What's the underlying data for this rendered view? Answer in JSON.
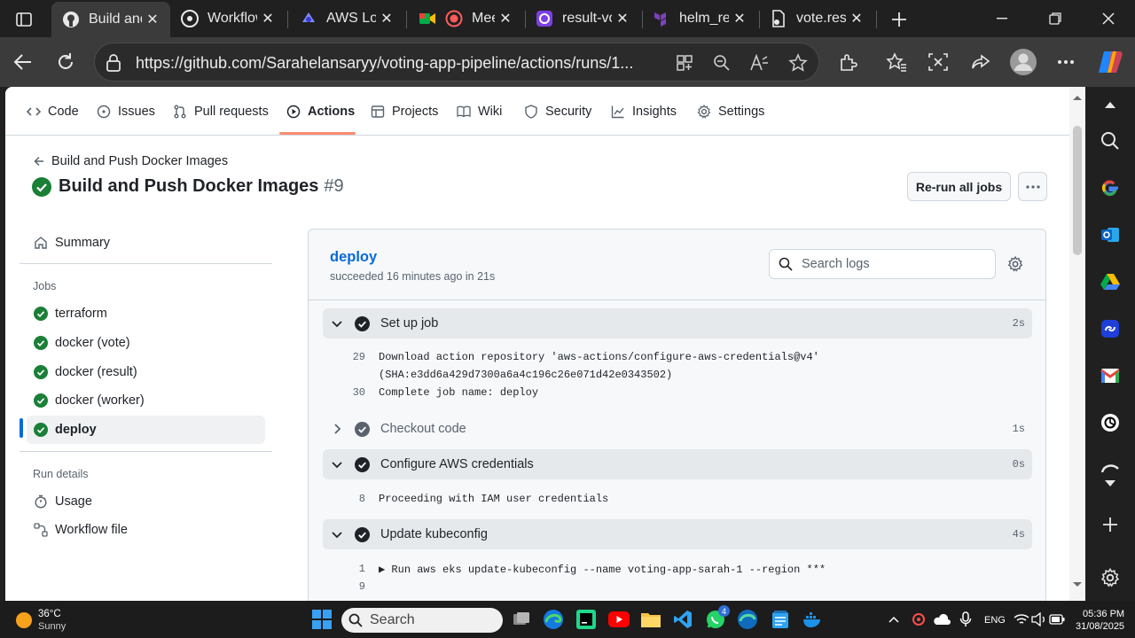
{
  "browser": {
    "tabs": [
      {
        "title": "Build and Push Docker Images",
        "active": true
      },
      {
        "title": "Workflow runs",
        "active": false
      },
      {
        "title": "AWS Load Balancer",
        "active": false
      },
      {
        "title": "Meet",
        "active": false
      },
      {
        "title": "result-voting",
        "active": false
      },
      {
        "title": "helm_release",
        "active": false
      },
      {
        "title": "vote.result",
        "active": false
      }
    ],
    "url": "https://github.com/Sarahelansaryy/voting-app-pipeline/actions/runs/1..."
  },
  "repo_nav": {
    "items": [
      {
        "label": "Code",
        "icon": "code-icon"
      },
      {
        "label": "Issues",
        "icon": "issue-opened-icon"
      },
      {
        "label": "Pull requests",
        "icon": "git-pull-request-icon"
      },
      {
        "label": "Actions",
        "icon": "play-icon",
        "active": true
      },
      {
        "label": "Projects",
        "icon": "table-icon"
      },
      {
        "label": "Wiki",
        "icon": "book-icon"
      },
      {
        "label": "Security",
        "icon": "shield-icon"
      },
      {
        "label": "Insights",
        "icon": "graph-icon"
      },
      {
        "label": "Settings",
        "icon": "gear-icon"
      }
    ]
  },
  "run": {
    "back_label": "Build and Push Docker Images",
    "title": "Build and Push Docker Images",
    "number": "#9",
    "rerun_label": "Re-run all jobs"
  },
  "sidebar": {
    "summary": "Summary",
    "jobs_heading": "Jobs",
    "jobs": [
      {
        "label": "terraform",
        "status": "success"
      },
      {
        "label": "docker (vote)",
        "status": "success"
      },
      {
        "label": "docker (result)",
        "status": "success"
      },
      {
        "label": "docker (worker)",
        "status": "success"
      },
      {
        "label": "deploy",
        "status": "success",
        "active": true
      }
    ],
    "run_details_heading": "Run details",
    "usage": "Usage",
    "workflow_file": "Workflow file"
  },
  "job": {
    "name": "deploy",
    "subtitle": "succeeded 16 minutes ago in 21s",
    "search_placeholder": "Search logs",
    "steps": [
      {
        "label": "Set up job",
        "duration": "2s",
        "expanded": true,
        "lines": [
          {
            "n": "29",
            "text": "Download action repository 'aws-actions/configure-aws-credentials@v4'"
          },
          {
            "n": "",
            "text": "(SHA:e3dd6a429d7300a6a4c196c26e071d42e0343502)"
          },
          {
            "n": "30",
            "text": "Complete job name: deploy"
          }
        ]
      },
      {
        "label": "Checkout code",
        "duration": "1s",
        "expanded": false,
        "lines": []
      },
      {
        "label": "Configure AWS credentials",
        "duration": "0s",
        "expanded": true,
        "lines": [
          {
            "n": "8",
            "text": "Proceeding with IAM user credentials"
          }
        ]
      },
      {
        "label": "Update kubeconfig",
        "duration": "4s",
        "expanded": true,
        "lines": [
          {
            "n": "1",
            "text": "▶ Run aws eks update-kubeconfig --name voting-app-sarah-1 --region ***"
          },
          {
            "n": "9",
            "text": ""
          }
        ]
      }
    ]
  },
  "taskbar": {
    "weather_temp": "36°C",
    "weather_desc": "Sunny",
    "search_label": "Search",
    "lang": "ENG",
    "time": "05:36 PM",
    "date": "31/08/2025",
    "whatsapp_badge": "4"
  },
  "colors": {
    "success": "#1a7f37",
    "link": "#0969da",
    "actions_underline": "#fd8c73"
  }
}
